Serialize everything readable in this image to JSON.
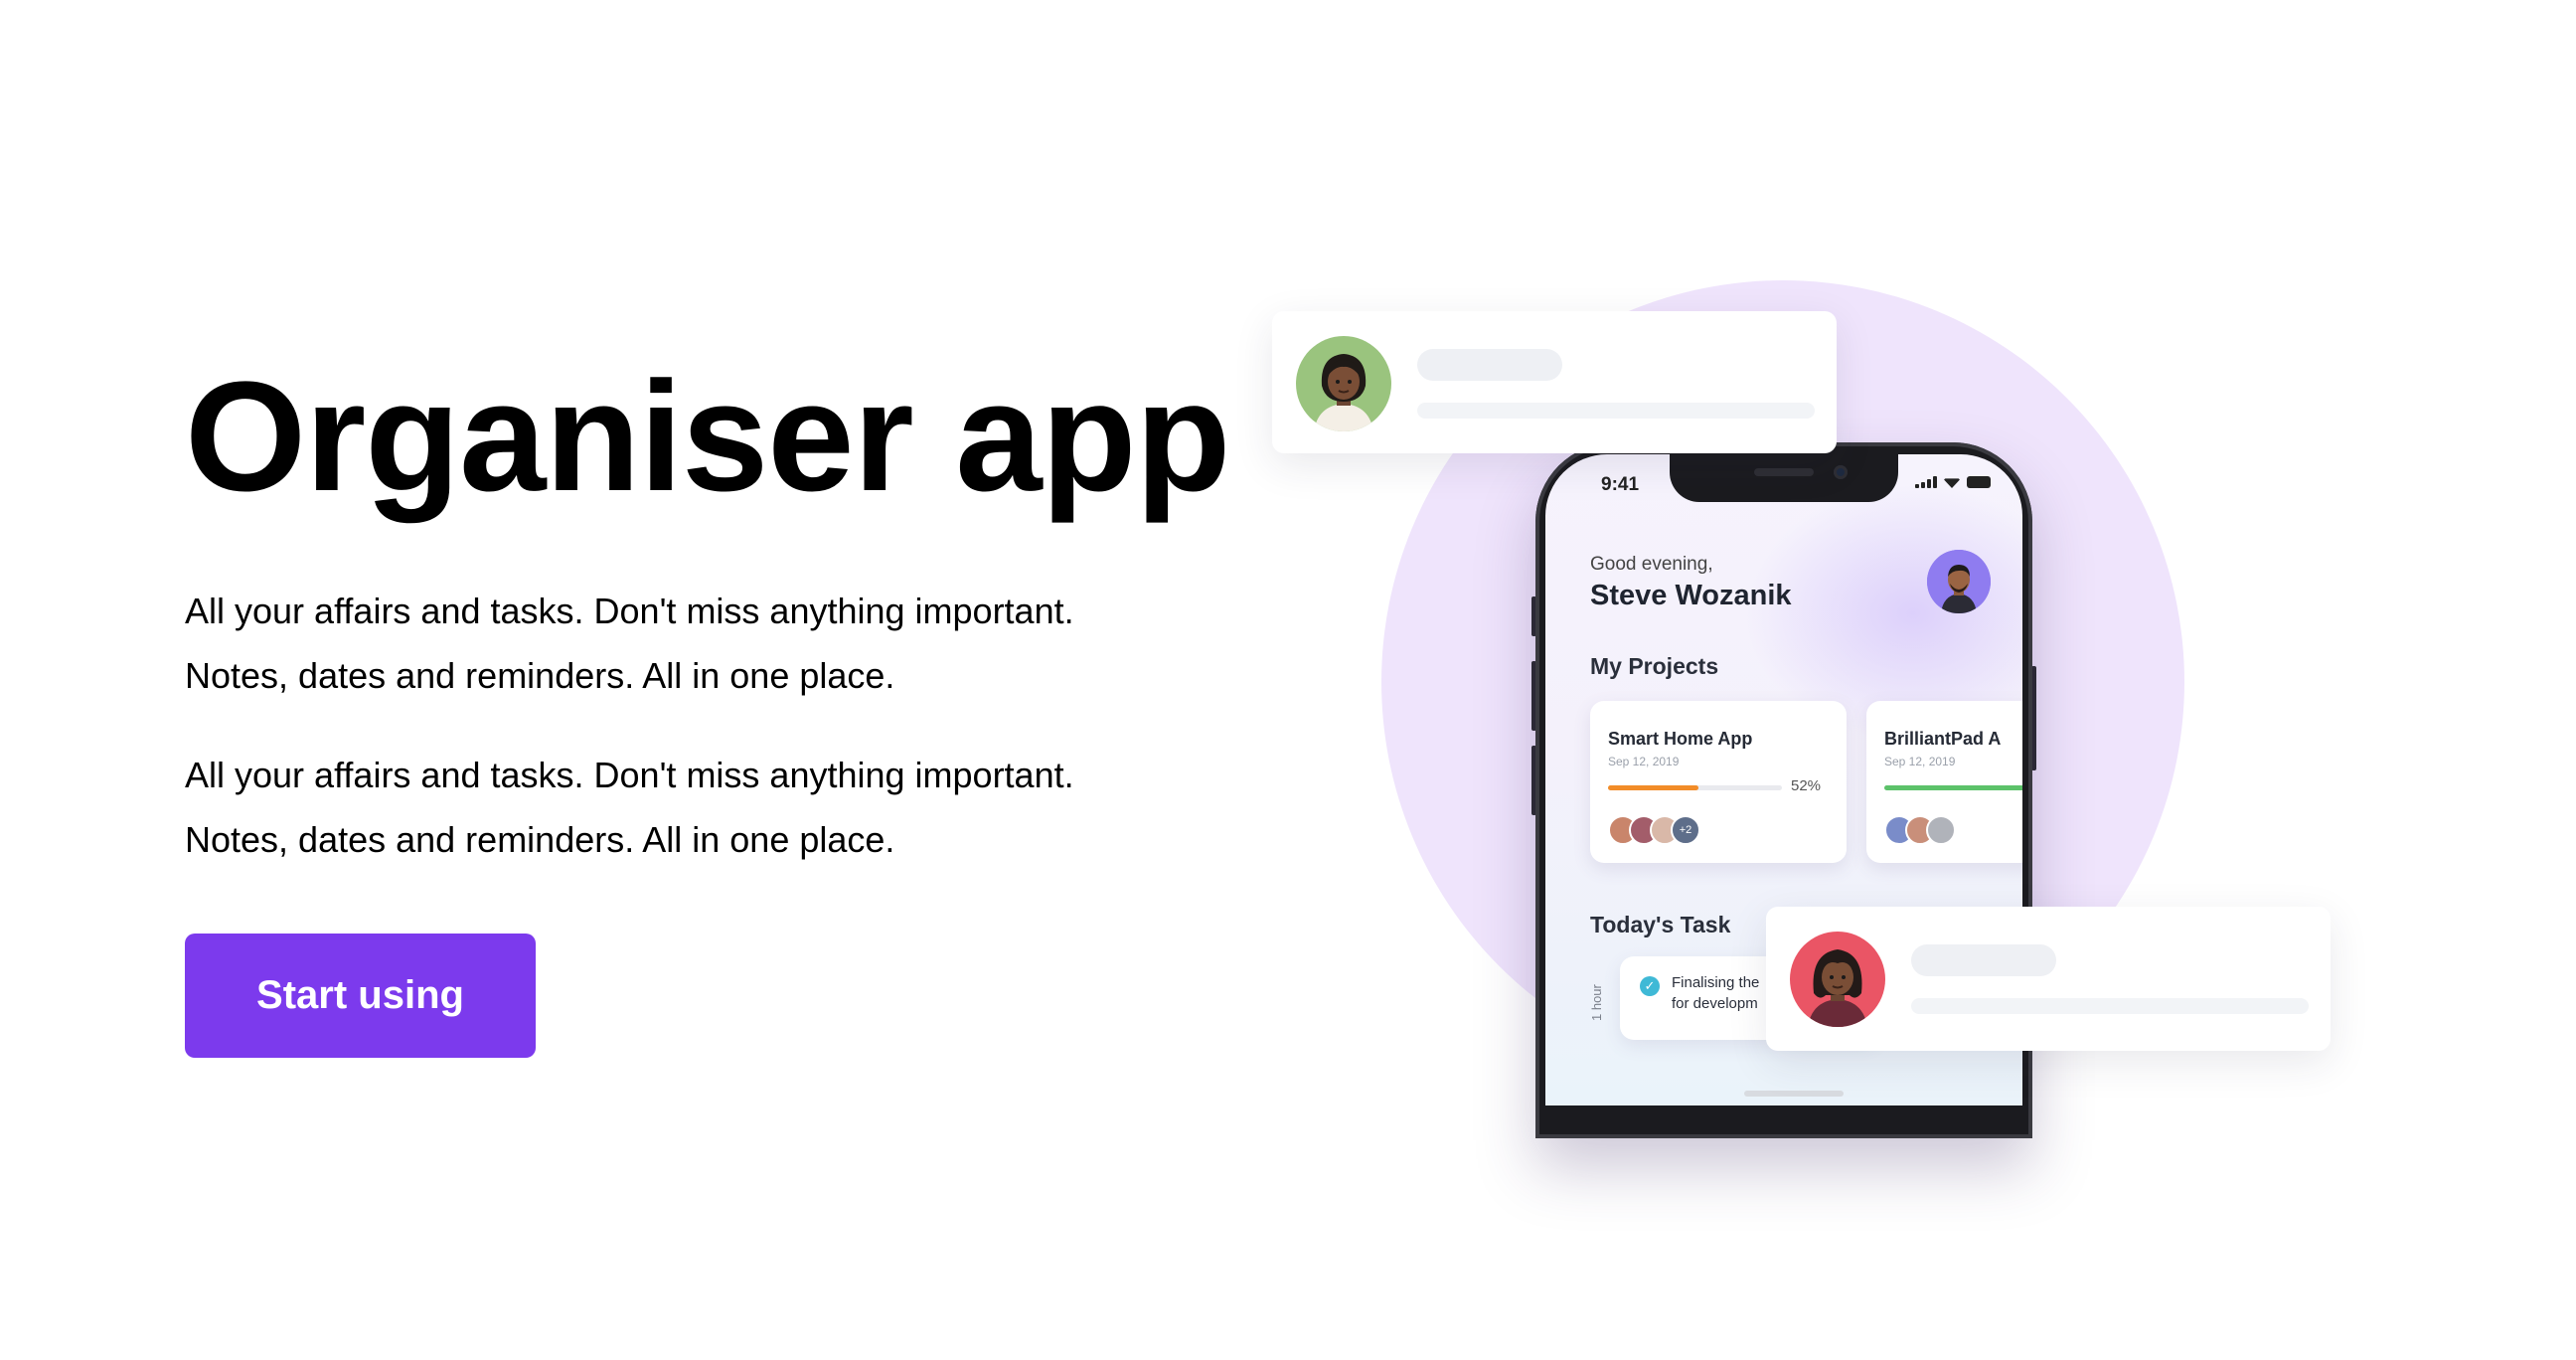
{
  "hero": {
    "title": "Organiser app",
    "paragraph_1": [
      "All your affairs and tasks. Don't miss anything important.",
      "Notes, dates and reminders. All in one place."
    ],
    "paragraph_2": [
      "All your affairs and tasks. Don't miss anything important.",
      "Notes, dates and reminders. All in one place."
    ],
    "cta_label": "Start using"
  },
  "colors": {
    "accent": "#7c3aed",
    "circle": "#efe4fc",
    "progress_orange": "#f28c28",
    "progress_green": "#5cc26a"
  },
  "phone": {
    "status_time": "9:41",
    "greeting": "Good evening,",
    "user_name": "Steve Wozanik",
    "projects_title": "My Projects",
    "projects": [
      {
        "name": "Smart Home App",
        "date": "Sep 12, 2019",
        "progress_percent": 52,
        "progress_label": "52%",
        "extra_members": "+2"
      },
      {
        "name": "BrilliantPad A",
        "date": "Sep 12, 2019",
        "progress_percent": 100
      }
    ],
    "today_title": "Today's Task",
    "task_duration": "1 hour",
    "task_text": [
      "Finalising the",
      "for developm"
    ]
  },
  "icons": {
    "user_avatar": "man-avatar-icon",
    "notif_top_avatar": "woman-avatar-icon",
    "notif_bottom_avatar": "woman-avatar-icon",
    "task_status": "check-icon"
  }
}
